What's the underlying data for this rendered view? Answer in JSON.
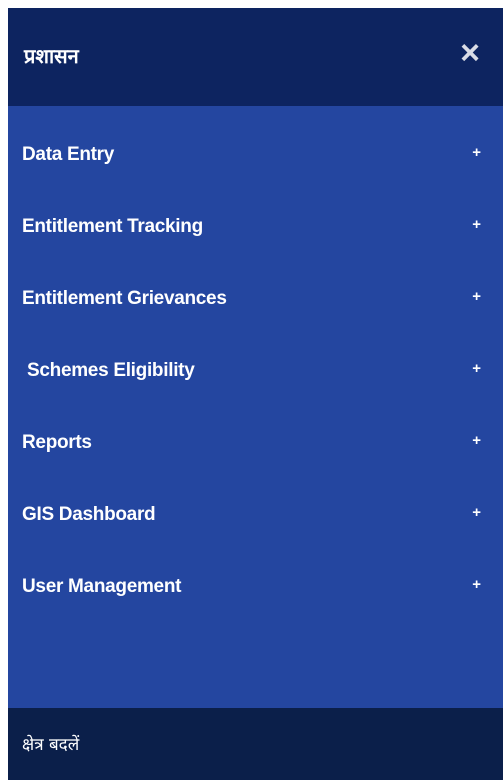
{
  "header": {
    "title": "प्रशासन",
    "close_icon": "close-icon"
  },
  "menu": {
    "items": [
      {
        "label": "Data Entry",
        "expand": "+"
      },
      {
        "label": "Entitlement Tracking",
        "expand": "+"
      },
      {
        "label": "Entitlement Grievances",
        "expand": "+"
      },
      {
        "label": "Schemes Eligibility",
        "expand": "+"
      },
      {
        "label": "Reports",
        "expand": "+"
      },
      {
        "label": "GIS Dashboard",
        "expand": "+"
      },
      {
        "label": "User Management",
        "expand": "+"
      }
    ]
  },
  "footer": {
    "label": "क्षेत्र बदलें"
  },
  "colors": {
    "header_bg": "#0d2460",
    "menu_bg": "#2446a0",
    "footer_bg": "#0b1f4a",
    "text": "#ffffff"
  }
}
